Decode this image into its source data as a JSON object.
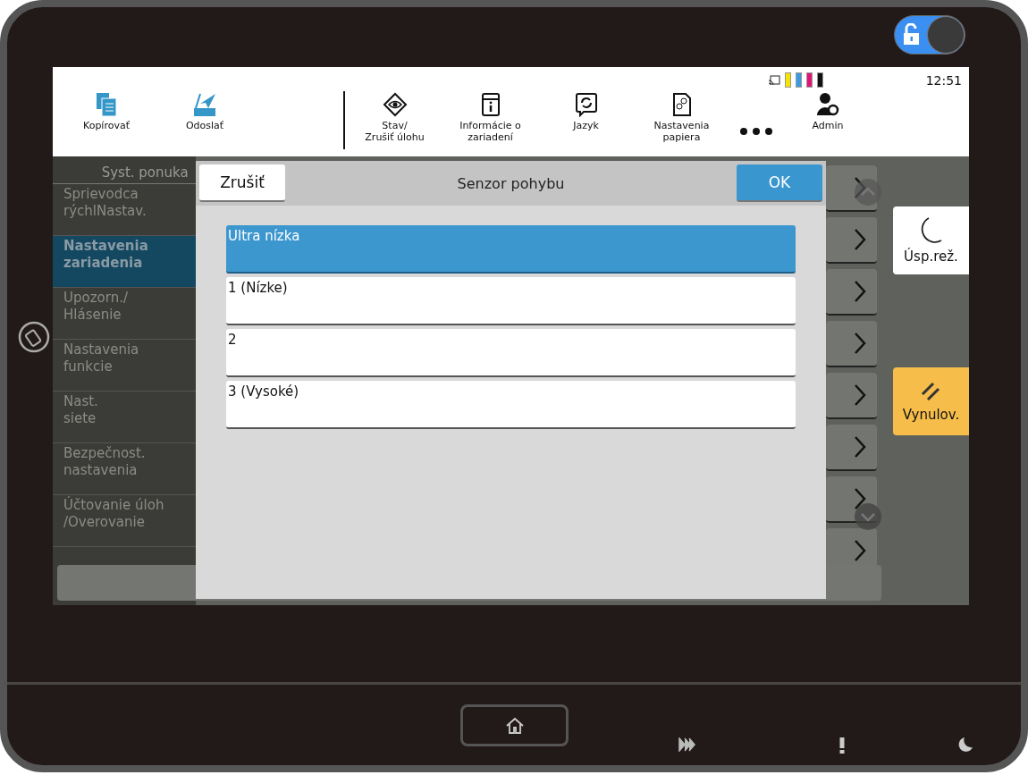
{
  "lock_switch": {
    "on": true
  },
  "status": {
    "toners": [
      {
        "color": "#f5e400"
      },
      {
        "color": "#3a9be0"
      },
      {
        "color": "#e0157a"
      },
      {
        "color": "#111111"
      }
    ],
    "time": "12:51"
  },
  "toolbar": {
    "left": [
      {
        "label": "Kopírovať",
        "kind": "copy"
      },
      {
        "label": "Odoslať",
        "kind": "send"
      }
    ],
    "right": [
      {
        "label": "Stav/\nZrušiť úlohu",
        "kind": "status"
      },
      {
        "label": "Informácie o\nzariadení",
        "kind": "info"
      },
      {
        "label": "Jazyk",
        "kind": "language"
      },
      {
        "label": "Nastavenia\npapiera",
        "kind": "paper"
      },
      {
        "kind": "more"
      },
      {
        "label": "Admin",
        "kind": "admin"
      }
    ]
  },
  "sidebar": {
    "title": "Syst. ponuka",
    "items": [
      {
        "label": "Sprievodca\nrýchlNastav.",
        "selected": false
      },
      {
        "label": "Nastavenia\nzariadenia",
        "selected": true
      },
      {
        "label": "Upozorn./\nHlásenie",
        "selected": false
      },
      {
        "label": "Nastavenia\nfunkcie",
        "selected": false
      },
      {
        "label": "Nast.\nsiete",
        "selected": false
      },
      {
        "label": "Bezpečnost.\nnastavenia",
        "selected": false
      },
      {
        "label": "Účtovanie úloh\n/Overovanie",
        "selected": false
      }
    ]
  },
  "dialog": {
    "cancel": "Zrušiť",
    "title": "Senzor pohybu",
    "ok": "OK",
    "options": [
      {
        "label": "Ultra nízka",
        "selected": true
      },
      {
        "label": "1 (Nízke)",
        "selected": false
      },
      {
        "label": "2",
        "selected": false
      },
      {
        "label": "3 (Vysoké)",
        "selected": false
      }
    ]
  },
  "side_buttons": [
    {
      "label": "Úsp.rež.",
      "kind": "sleep"
    },
    {
      "label": "Vynulov.",
      "kind": "reset"
    }
  ]
}
